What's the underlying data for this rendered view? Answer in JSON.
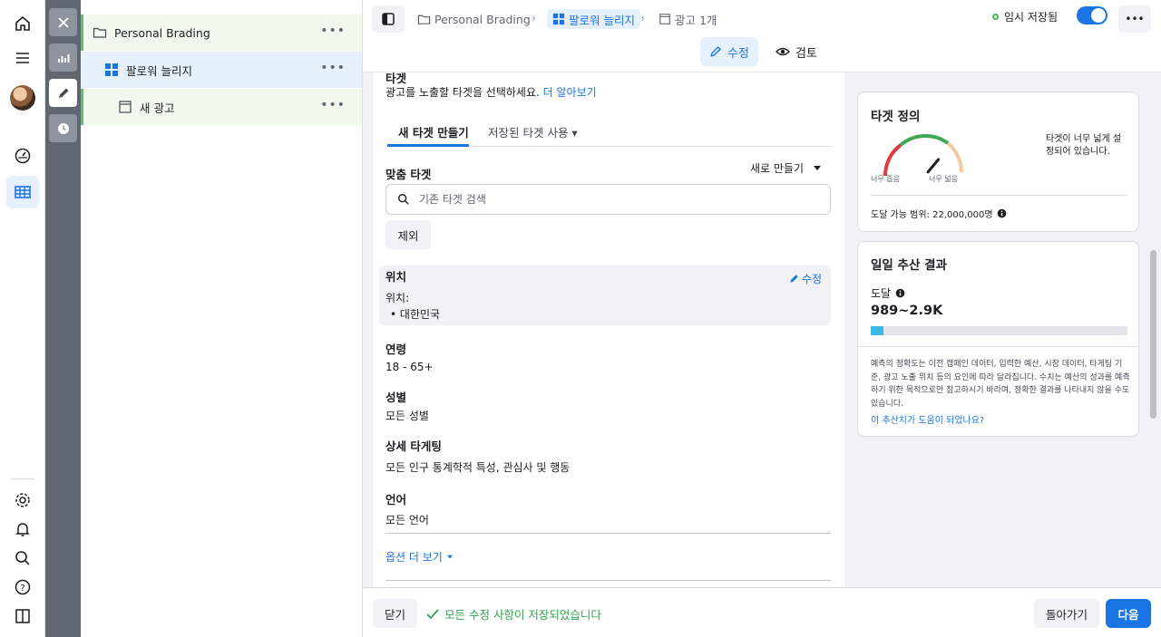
{
  "colors": {
    "accent": "#1b74e4",
    "success": "#31a24c",
    "tree_marker": "#5ac26f",
    "progress": "#3bb8e8"
  },
  "global_nav": {
    "icons": [
      "home-icon",
      "menu-icon",
      "avatar",
      "dashboard-icon",
      "table-icon",
      "gear-icon",
      "bell-icon",
      "search-icon",
      "help-icon",
      "panel-toggle-icon"
    ]
  },
  "tool_strip": {
    "icons": [
      "close-icon",
      "chart-icon",
      "pencil-icon",
      "clock-icon"
    ]
  },
  "tree": {
    "items": [
      {
        "label": "Personal Brading",
        "icon": "folder-icon"
      },
      {
        "label": "팔로워 늘리지",
        "icon": "grid-icon"
      },
      {
        "label": "새 광고",
        "icon": "ad-icon"
      }
    ],
    "more": "•••"
  },
  "topbar": {
    "breadcrumbs": [
      {
        "label": "Personal Brading",
        "icon": "folder-icon"
      },
      {
        "label": "팔로워 늘리지",
        "icon": "grid-icon"
      },
      {
        "label": "광고 1개",
        "icon": "ad-icon"
      }
    ],
    "save_status": "임시 저장됨",
    "more": "•••",
    "modes": [
      {
        "label": "수정",
        "icon": "pencil-icon"
      },
      {
        "label": "검토",
        "icon": "eye-icon"
      }
    ]
  },
  "form": {
    "section_title": "타겟",
    "section_desc": "광고를 노출할 타겟을 선택하세요.",
    "learn_more": "더 알아보기",
    "tabs": [
      "새 타겟 만들기",
      "저장된 타겟 사용 ▾"
    ],
    "custom_audience": {
      "label": "맞춤 타겟",
      "create_new": "새로 만들기",
      "search_placeholder": "기존 타겟 검색",
      "exclude": "제외"
    },
    "location": {
      "label": "위치",
      "edit": "수정",
      "sub": "위치:",
      "values": [
        "대한민국"
      ]
    },
    "age": {
      "label": "연령",
      "value": "18 - 65+"
    },
    "gender": {
      "label": "성별",
      "value": "모든 성별"
    },
    "detailed": {
      "label": "상세 타게팅",
      "value": "모든 인구 통계학적 특성, 관심사 및 행동"
    },
    "language": {
      "label": "언어",
      "value": "모든 언어"
    },
    "more_options": "옵션 더 보기"
  },
  "definition_card": {
    "title": "타겟 정의",
    "gauge_low": "너무 좁음",
    "gauge_high": "너무 넓음",
    "message": "타겟이 너무 넓게 설정되어 있습니다.",
    "reach": "도달 가능 범위: 22,000,000명",
    "gauge_level": 0.72
  },
  "results_card": {
    "title": "일일 추산 결과",
    "metric": "도달",
    "value": "989~2.9K",
    "fill": 0.05,
    "disclaimer": "예측의 정확도는 이전 캠페인 데이터, 입력한 예산, 시장 데이터, 타게팅 기준, 광고 노출 위치 등의 요인에 따라 달라집니다. 수치는 예산의 성과를 예측하기 위한 목적으로만 참고하시기 바라며, 정확한 결과를 나타내지 않을 수도 있습니다.",
    "feedback": "이 추산치가 도움이 되었나요?"
  },
  "footer": {
    "close": "닫기",
    "saved": "모든 수정 사항이 저장되었습니다",
    "back": "돌아가기",
    "next": "다음"
  }
}
